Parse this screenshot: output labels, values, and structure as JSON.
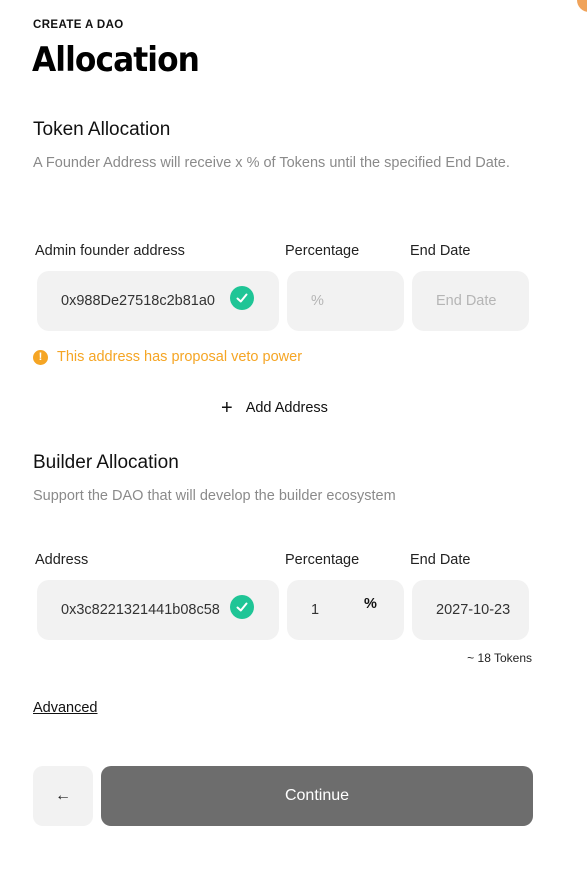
{
  "header": {
    "eyebrow": "CREATE A DAO",
    "title": "Allocation"
  },
  "token_allocation": {
    "title": "Token Allocation",
    "description": "A Founder Address will receive x % of Tokens until the specified End Date.",
    "labels": {
      "address": "Admin founder address",
      "percentage": "Percentage",
      "end_date": "End Date"
    },
    "address_value": "0x988De27518c2b81a0",
    "percentage_placeholder": "%",
    "end_date_placeholder": "End Date",
    "warning": "This address has proposal veto power",
    "warning_icon": "!",
    "add_address_label": "Add Address",
    "add_icon": "+"
  },
  "builder_allocation": {
    "title": "Builder Allocation",
    "description": "Support the DAO that will develop the builder ecosystem",
    "labels": {
      "address": "Address",
      "percentage": "Percentage",
      "end_date": "End Date"
    },
    "address_value": "0x3c8221321441b08c58",
    "percentage_value": "1",
    "percentage_unit": "%",
    "end_date_value": "2027-10-23",
    "tokens_note": "~ 18 Tokens"
  },
  "footer": {
    "advanced_label": "Advanced",
    "back_icon": "←",
    "continue_label": "Continue"
  },
  "colors": {
    "success": "#1fc596",
    "warning": "#f5a524",
    "continue_bg": "#6d6d6d",
    "input_bg": "#f2f2f2"
  }
}
